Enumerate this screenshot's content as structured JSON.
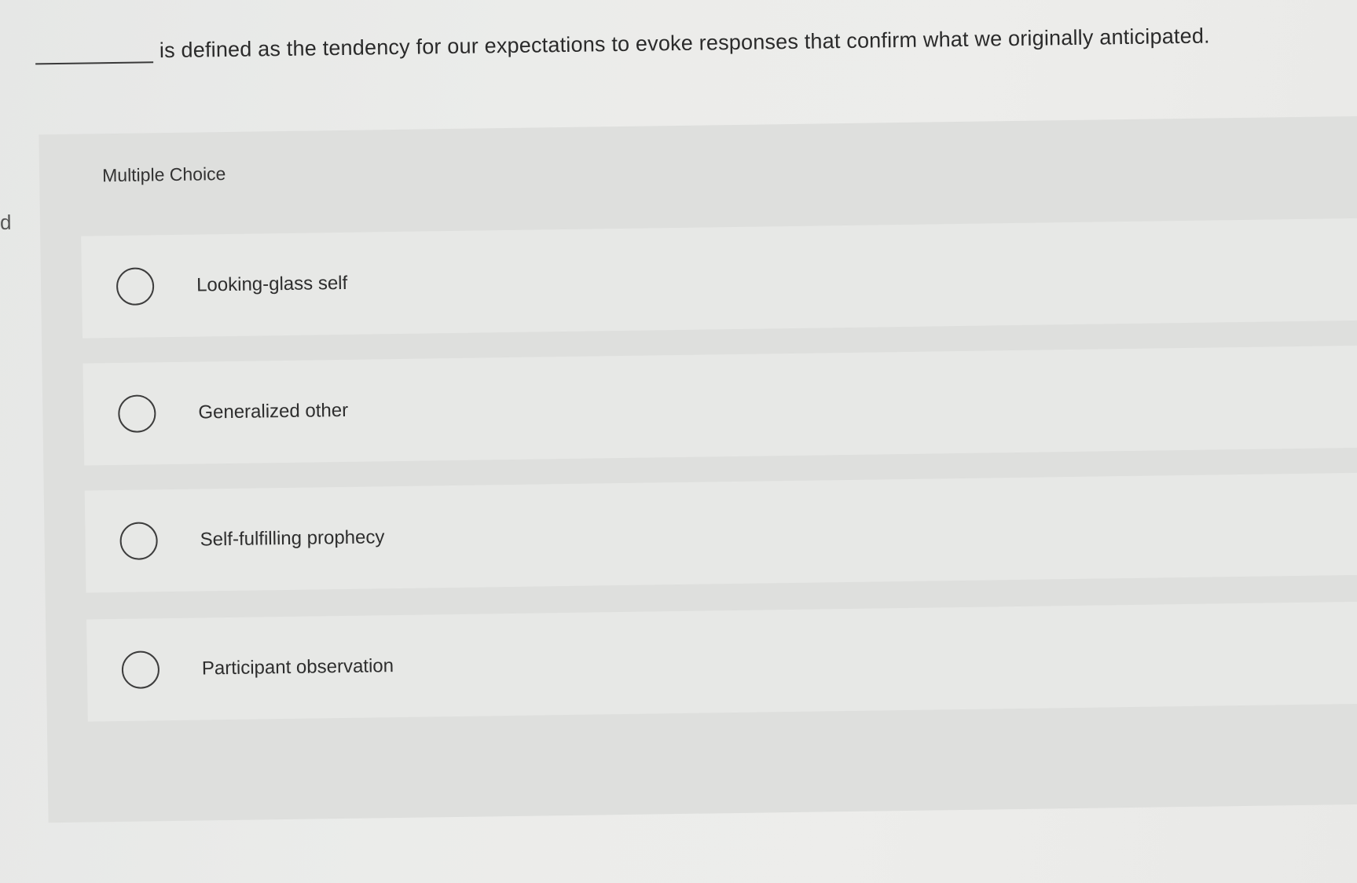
{
  "edge_text": "d",
  "question": {
    "text": "is defined as the tendency for our expectations to evoke responses that confirm what we originally anticipated."
  },
  "multiple_choice": {
    "heading": "Multiple Choice",
    "options": [
      {
        "label": "Looking-glass self",
        "selected": false
      },
      {
        "label": "Generalized other",
        "selected": false
      },
      {
        "label": "Self-fulfilling prophecy",
        "selected": false
      },
      {
        "label": "Participant observation",
        "selected": false
      }
    ]
  }
}
